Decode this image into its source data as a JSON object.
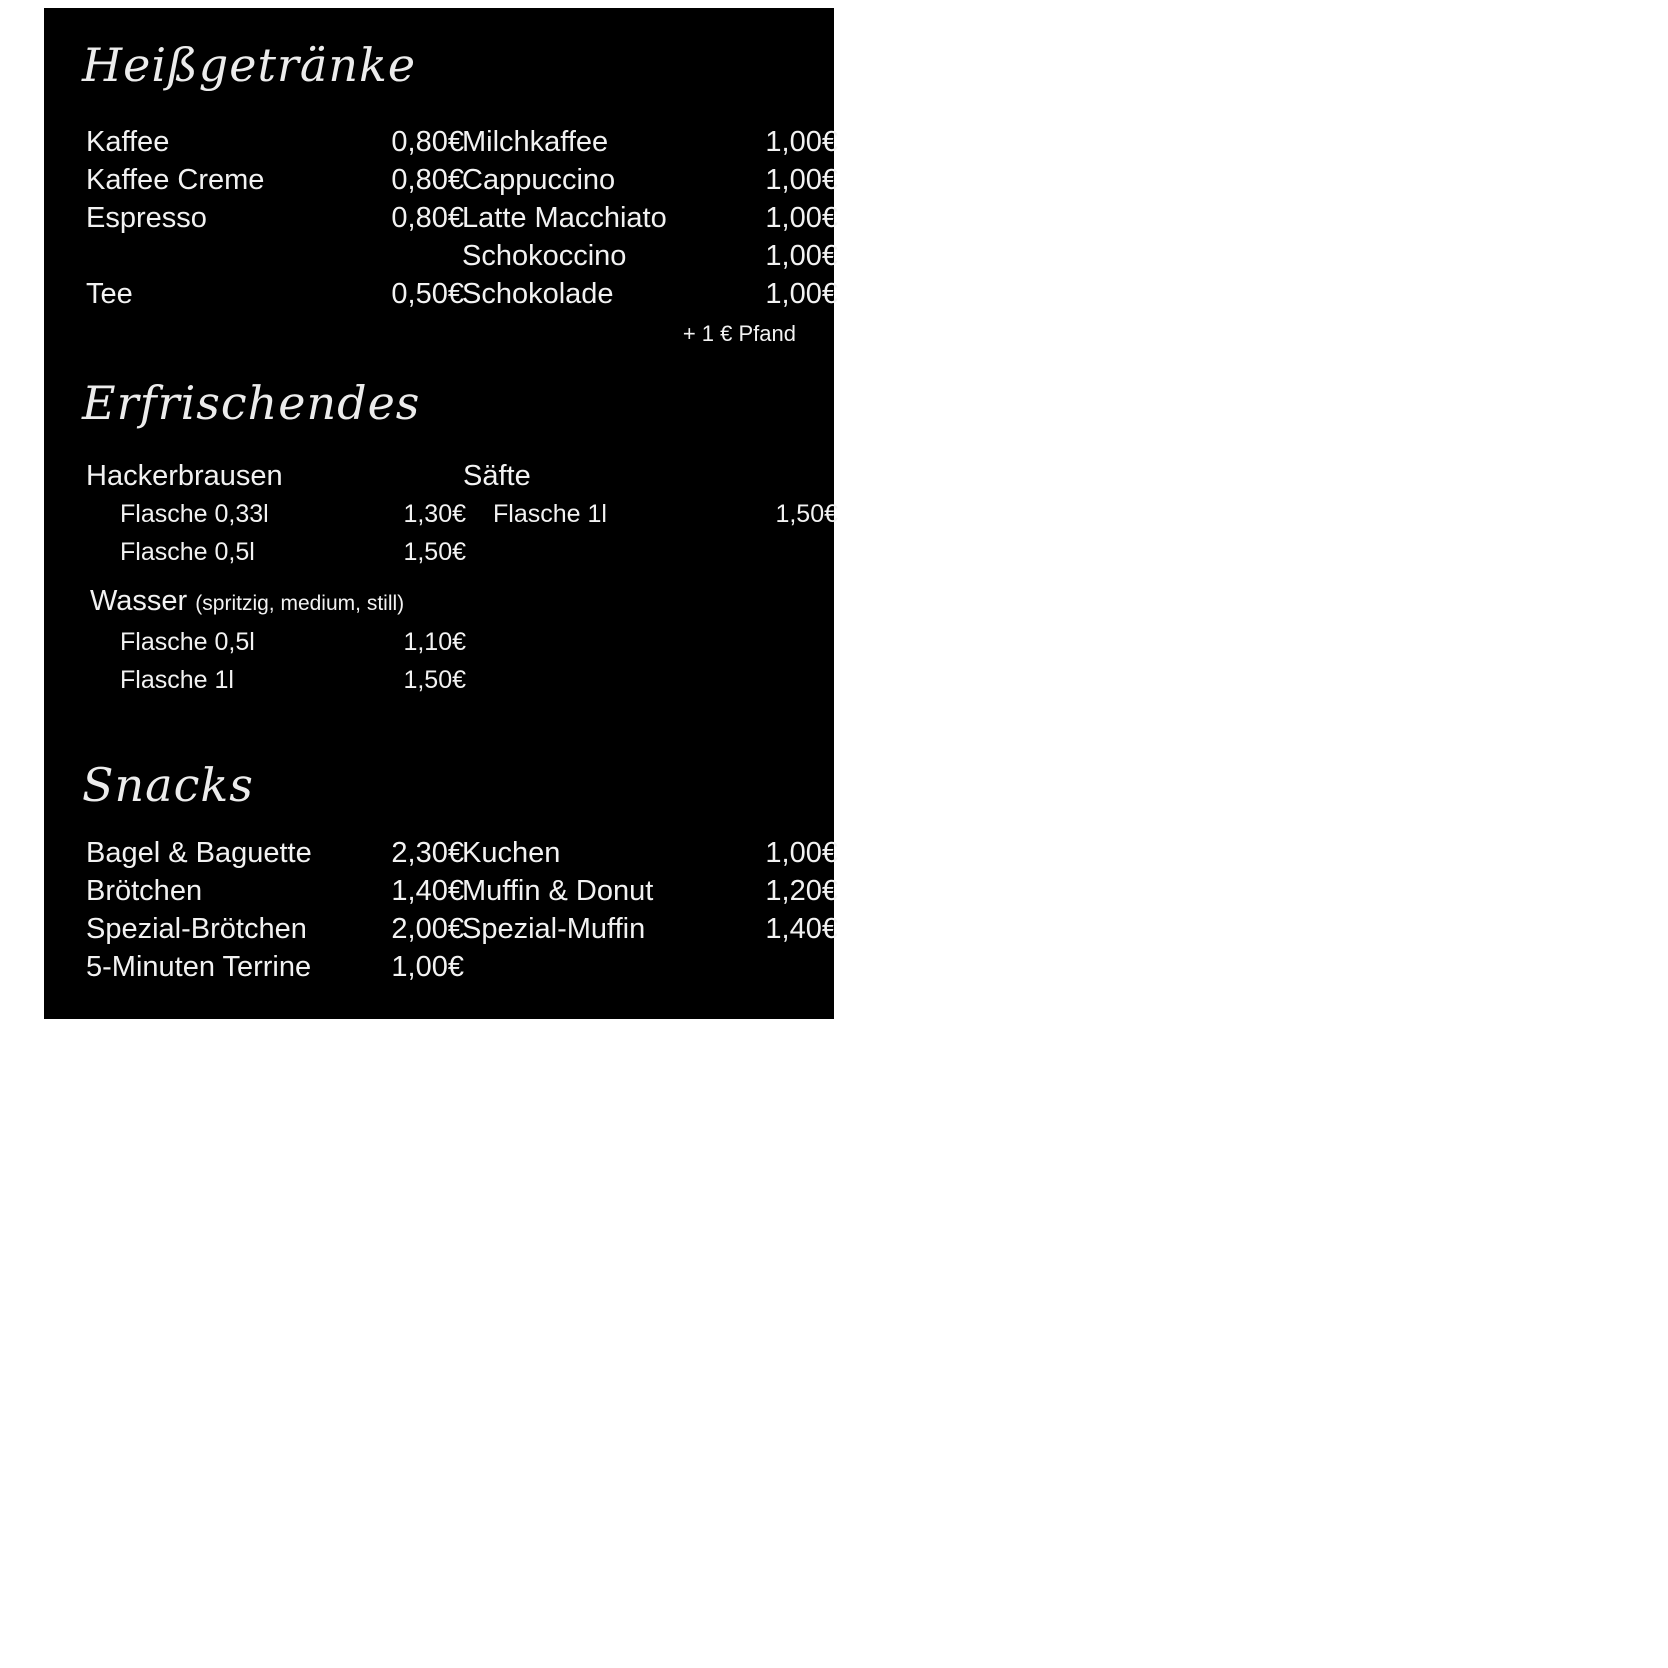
{
  "hot": {
    "title": "Heißgetränke",
    "left": [
      {
        "name": "Kaffee",
        "price": "0,80€"
      },
      {
        "name": "Kaffee Creme",
        "price": "0,80€"
      },
      {
        "name": "Espresso",
        "price": "0,80€"
      },
      {
        "name": "Tee",
        "price": "0,50€"
      }
    ],
    "right": [
      {
        "name": "Milchkaffee",
        "price": "1,00€"
      },
      {
        "name": "Cappuccino",
        "price": "1,00€"
      },
      {
        "name": "Latte Macchiato",
        "price": "1,00€"
      },
      {
        "name": "Schokoccino",
        "price": "1,00€"
      },
      {
        "name": "Schokolade",
        "price": "1,00€"
      }
    ],
    "deposit_note": "+ 1 € Pfand"
  },
  "cold": {
    "title": "Erfrischendes",
    "hackerbrausen": {
      "label": "Hackerbrausen",
      "items": [
        {
          "name": "Flasche 0,33l",
          "price": "1,30€"
        },
        {
          "name": "Flasche 0,5l",
          "price": "1,50€"
        }
      ]
    },
    "wasser": {
      "label": "Wasser",
      "sub": "(spritzig, medium, still)",
      "items": [
        {
          "name": "Flasche 0,5l",
          "price": "1,10€"
        },
        {
          "name": "Flasche 1l",
          "price": "1,50€"
        }
      ]
    },
    "saefte": {
      "label": "Säfte",
      "items": [
        {
          "name": "Flasche 1l",
          "price": "1,50€"
        }
      ]
    }
  },
  "snacks": {
    "title": "Snacks",
    "left": [
      {
        "name": "Bagel & Baguette",
        "price": "2,30€"
      },
      {
        "name": "Brötchen",
        "price": "1,40€"
      },
      {
        "name": "Spezial-Brötchen",
        "price": "2,00€"
      },
      {
        "name": "5-Minuten Terrine",
        "price": "1,00€"
      }
    ],
    "right": [
      {
        "name": "Kuchen",
        "price": "1,00€"
      },
      {
        "name": "Muffin & Donut",
        "price": "1,20€"
      },
      {
        "name": "Spezial-Muffin",
        "price": "1,40€"
      }
    ]
  }
}
